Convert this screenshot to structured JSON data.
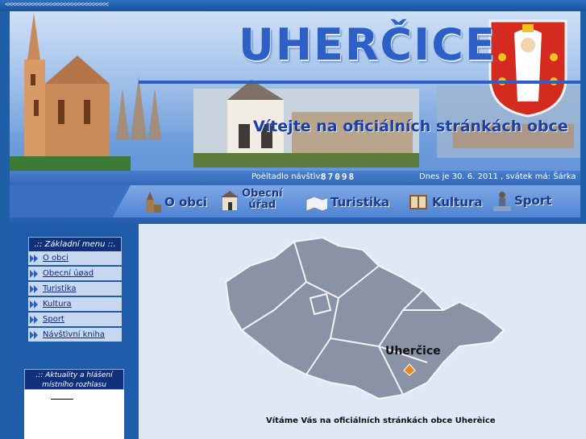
{
  "top": {
    "arrows": "<<<<<<<<<<<<<<<<<<<<<<<<<<<<<"
  },
  "banner": {
    "title": "UHERČICE",
    "welcome": "Vítejte na oficiálních stránkách obce"
  },
  "infobar": {
    "counter_label": "Poèítadlo návštìv:",
    "counter_value": "87098",
    "date_text": "Dnes je 30. 6. 2011 , svátek má: Šárka"
  },
  "nav": {
    "items": [
      {
        "label": "O obci",
        "icon": "church-icon"
      },
      {
        "label": "Obecní",
        "label2": "úřad",
        "icon": "townhall-icon"
      },
      {
        "label": "Turistika",
        "icon": "map-icon"
      },
      {
        "label": "Kultura",
        "icon": "book-icon"
      },
      {
        "label": "Sport",
        "icon": "sport-icon"
      }
    ]
  },
  "sidebar": {
    "menu_title": ".:: Základní menu ::.",
    "items": [
      {
        "label": "O obci"
      },
      {
        "label": "Obecní úøad"
      },
      {
        "label": "Turistika"
      },
      {
        "label": "Kultura"
      },
      {
        "label": "Sport"
      },
      {
        "label": "Návštìvní kniha"
      }
    ],
    "news_title": ".:: Aktuality a hlášení místního rozhlasu"
  },
  "content": {
    "map_label": "Uherčice",
    "welcome_footer": "Vítáme Vás na oficiálních stránkách obce Uherèice"
  },
  "colors": {
    "accent": "#2d5fc6",
    "background": "#1f5fa8",
    "content_bg": "#dfe8f5",
    "map_fill": "#8a93a6"
  }
}
